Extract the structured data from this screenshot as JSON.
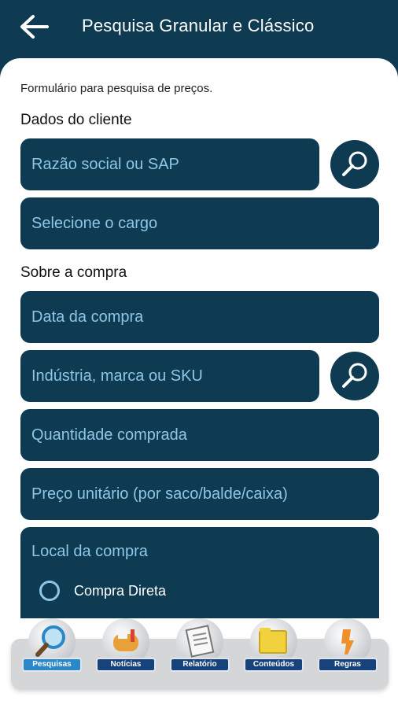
{
  "header": {
    "title": "Pesquisa Granular e Clássico",
    "back_icon": "arrow-left-icon"
  },
  "form": {
    "intro": "Formulário para pesquisa de preços.",
    "section_client": "Dados do cliente",
    "razao_social_placeholder": "Razão social ou SAP",
    "cargo_placeholder": "Selecione o cargo",
    "section_purchase": "Sobre a compra",
    "data_compra_placeholder": "Data da compra",
    "industria_placeholder": "Indústria, marca ou SKU",
    "quantidade_placeholder": "Quantidade comprada",
    "preco_placeholder": "Preço unitário (por saco/balde/caixa)",
    "local_label": "Local da compra",
    "local_options": [
      "Compra Direta"
    ]
  },
  "nav": {
    "items": [
      {
        "label": "Pesquisas",
        "icon": "magnifier-icon",
        "active": true
      },
      {
        "label": "Notícias",
        "icon": "mailbox-icon",
        "active": false
      },
      {
        "label": "Relatório",
        "icon": "document-icon",
        "active": false
      },
      {
        "label": "Conteúdos",
        "icon": "folder-icon",
        "active": false
      },
      {
        "label": "Regras",
        "icon": "tools-icon",
        "active": false
      }
    ]
  },
  "colors": {
    "primary": "#0e3a52",
    "field_text": "#8ec6e6",
    "nav_label": "#17427a",
    "nav_active": "#2a88c9"
  }
}
